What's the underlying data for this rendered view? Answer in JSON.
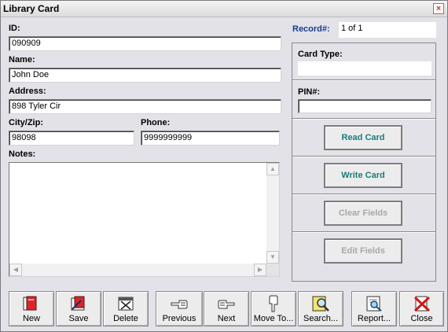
{
  "window": {
    "title": "Library Card",
    "close_glyph": "×"
  },
  "form": {
    "id_label": "ID:",
    "id_value": "090909",
    "name_label": "Name:",
    "name_value": "John Doe",
    "address_label": "Address:",
    "address_value": "898 Tyler Cir",
    "cityzip_label": "City/Zip:",
    "cityzip_value": "98098",
    "phone_label": "Phone:",
    "phone_value": "9999999999",
    "notes_label": "Notes:",
    "notes_value": ""
  },
  "record": {
    "label": "Record#:",
    "value": "1 of 1"
  },
  "card": {
    "card_type_label": "Card Type:",
    "card_type_value": "",
    "pin_label": "PIN#:",
    "pin_value": ""
  },
  "actions": {
    "read_card": "Read Card",
    "write_card": "Write Card",
    "clear_fields": "Clear Fields",
    "edit_fields": "Edit Fields"
  },
  "toolbar": {
    "new": "New",
    "save": "Save",
    "delete": "Delete",
    "previous": "Previous",
    "next": "Next",
    "move_to": "Move To...",
    "search": "Search...",
    "report": "Report...",
    "close": "Close"
  },
  "icons": {
    "close": "close-icon",
    "new": "new-record-icon",
    "save": "save-icon",
    "delete": "delete-icon",
    "previous": "hand-left-icon",
    "next": "hand-right-icon",
    "move_to": "hand-down-icon",
    "search": "magnifier-icon",
    "report": "report-icon",
    "toolbar_close": "red-x-icon"
  },
  "colors": {
    "active_button_text": "#1e7a7a",
    "disabled_button_text": "#a8a8a8",
    "record_label": "#1a3a8c"
  }
}
